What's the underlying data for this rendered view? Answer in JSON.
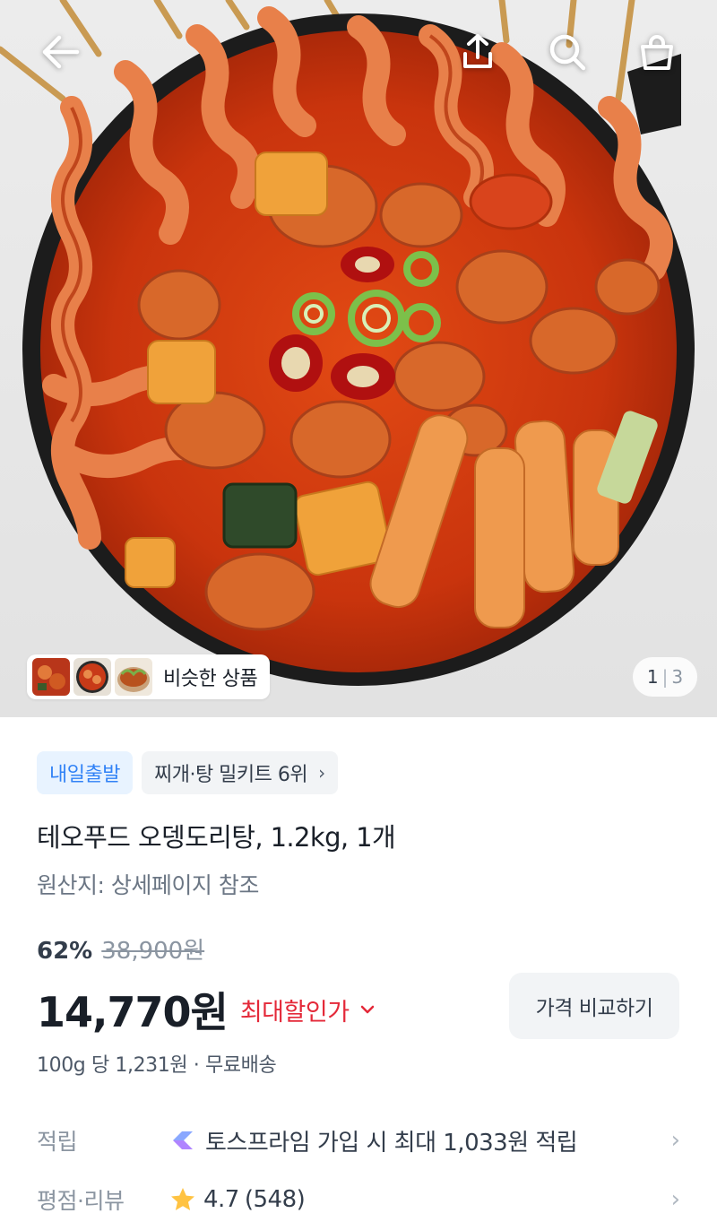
{
  "hero": {
    "similar_label": "비슷한 상품",
    "pager": {
      "current": "1",
      "separator": "|",
      "total": "3"
    }
  },
  "topbar": {
    "icons": [
      "back-arrow-icon",
      "share-icon",
      "search-icon",
      "cart-bag-icon"
    ]
  },
  "badges": {
    "delivery": "내일출발",
    "ranking": "찌개·탕 밀키트 6위",
    "ranking_chevron": "›"
  },
  "product": {
    "title": "테오푸드 오뎅도리탕, 1.2kg, 1개",
    "origin": "원산지: 상세페이지 참조",
    "discount_rate": "62%",
    "original_price": "38,900원",
    "price": "14,770원",
    "best_discount_label": "최대할인가",
    "compare_button": "가격 비교하기",
    "unit_price": "100g 당 1,231원 · 무료배송"
  },
  "details": {
    "points": {
      "label": "적립",
      "value": "토스프라임 가입 시 최대 1,033원 적립",
      "chevron": "›"
    },
    "rating": {
      "label": "평점·리뷰",
      "score": "4.7",
      "count": "(548)",
      "chevron": "›"
    }
  },
  "colors": {
    "accent_blue": "#3182f6",
    "discount_red": "#e42939",
    "star_yellow": "#ffc342"
  }
}
